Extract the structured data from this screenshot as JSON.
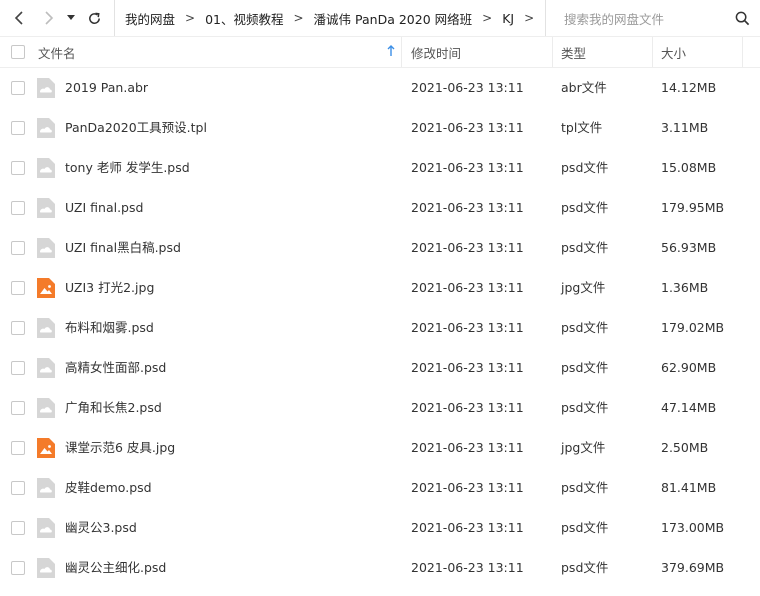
{
  "breadcrumbs": [
    "我的网盘",
    "01、视频教程",
    "潘诚伟 PanDa 2020 网络班",
    "KJ"
  ],
  "search": {
    "placeholder": "搜索我的网盘文件"
  },
  "columns": {
    "name": "文件名",
    "modified": "修改时间",
    "type": "类型",
    "size": "大小"
  },
  "colors": {
    "image_icon": "#f47b2a",
    "generic_icon": "#d6d6d6",
    "sort_arrow": "#3a8ee6"
  },
  "files": [
    {
      "name": "2019 Pan.abr",
      "modified": "2021-06-23 13:11",
      "type": "abr文件",
      "size": "14.12MB",
      "icon": "generic-file"
    },
    {
      "name": "PanDa2020工具预设.tpl",
      "modified": "2021-06-23 13:11",
      "type": "tpl文件",
      "size": "3.11MB",
      "icon": "generic-file"
    },
    {
      "name": "tony 老师 发学生.psd",
      "modified": "2021-06-23 13:11",
      "type": "psd文件",
      "size": "15.08MB",
      "icon": "generic-file"
    },
    {
      "name": "UZI final.psd",
      "modified": "2021-06-23 13:11",
      "type": "psd文件",
      "size": "179.95MB",
      "icon": "generic-file"
    },
    {
      "name": "UZI final黑白稿.psd",
      "modified": "2021-06-23 13:11",
      "type": "psd文件",
      "size": "56.93MB",
      "icon": "generic-file"
    },
    {
      "name": "UZI3 打光2.jpg",
      "modified": "2021-06-23 13:11",
      "type": "jpg文件",
      "size": "1.36MB",
      "icon": "image-file"
    },
    {
      "name": "布料和烟雾.psd",
      "modified": "2021-06-23 13:11",
      "type": "psd文件",
      "size": "179.02MB",
      "icon": "generic-file"
    },
    {
      "name": "高精女性面部.psd",
      "modified": "2021-06-23 13:11",
      "type": "psd文件",
      "size": "62.90MB",
      "icon": "generic-file"
    },
    {
      "name": "广角和长焦2.psd",
      "modified": "2021-06-23 13:11",
      "type": "psd文件",
      "size": "47.14MB",
      "icon": "generic-file"
    },
    {
      "name": "课堂示范6 皮具.jpg",
      "modified": "2021-06-23 13:11",
      "type": "jpg文件",
      "size": "2.50MB",
      "icon": "image-file"
    },
    {
      "name": "皮鞋demo.psd",
      "modified": "2021-06-23 13:11",
      "type": "psd文件",
      "size": "81.41MB",
      "icon": "generic-file"
    },
    {
      "name": "幽灵公3.psd",
      "modified": "2021-06-23 13:11",
      "type": "psd文件",
      "size": "173.00MB",
      "icon": "generic-file"
    },
    {
      "name": "幽灵公主细化.psd",
      "modified": "2021-06-23 13:11",
      "type": "psd文件",
      "size": "379.69MB",
      "icon": "generic-file"
    }
  ]
}
